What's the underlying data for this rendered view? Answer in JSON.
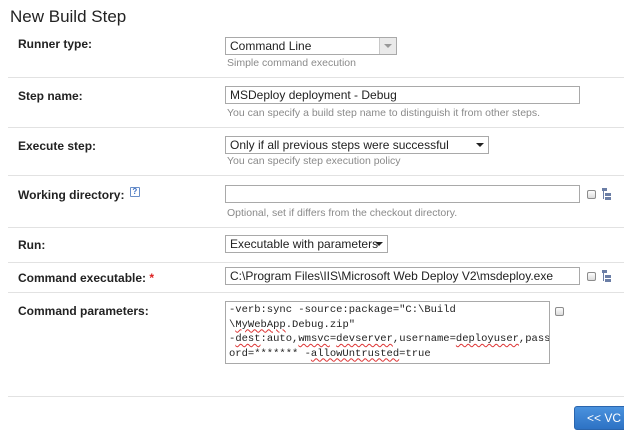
{
  "page": {
    "title": "New Build Step"
  },
  "runner_type": {
    "label": "Runner type:",
    "value": "Command Line",
    "note": "Simple command execution"
  },
  "step_name": {
    "label": "Step name:",
    "value": "MSDeploy deployment - Debug",
    "note": "You can specify a build step name to distinguish it from other steps."
  },
  "execute_step": {
    "label": "Execute step:",
    "value": "Only if all previous steps were successful",
    "note": "You can specify step execution policy"
  },
  "working_directory": {
    "label": "Working directory:",
    "help_icon": "?",
    "value": "",
    "note": "Optional, set if differs from the checkout directory."
  },
  "run": {
    "label": "Run:",
    "value": "Executable with parameters"
  },
  "command_executable": {
    "label": "Command executable:",
    "required_mark": "*",
    "value": "C:\\Program Files\\IIS\\Microsoft Web Deploy V2\\msdeploy.exe"
  },
  "command_parameters": {
    "label": "Command parameters:",
    "lines": [
      [
        "-verb:sync -source:package=\"C:\\Build"
      ],
      [
        "\\",
        {
          "sq": "MyWebApp"
        },
        ".Debug.zip\""
      ],
      [
        "-",
        {
          "sq": "dest"
        },
        ":auto,",
        {
          "sq": "wmsvc"
        },
        "=",
        {
          "sq": "devserver"
        },
        ",username=",
        {
          "sq": "deployuser"
        },
        ",passw"
      ],
      [
        "ord=******* -",
        {
          "sq": "allowUntrusted"
        },
        "=true"
      ]
    ]
  },
  "footer": {
    "back_button_label": "<< VC"
  },
  "colors": {
    "accent": "#2d72c4",
    "required": "#dd2222",
    "note": "#8a8a8a"
  }
}
